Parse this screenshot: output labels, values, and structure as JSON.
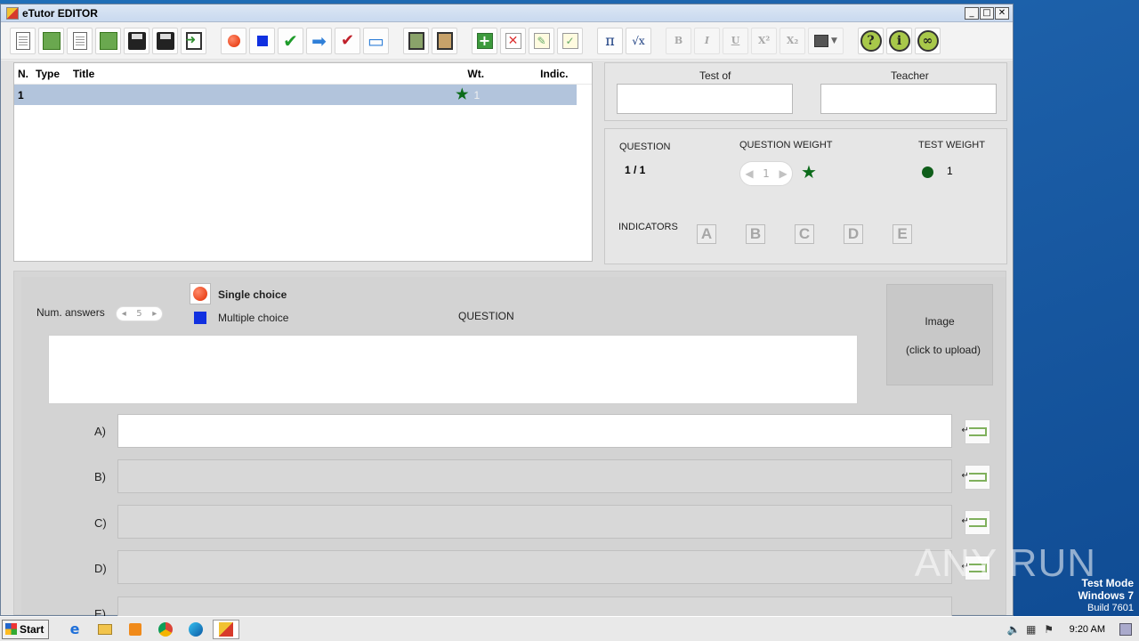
{
  "window": {
    "title": "eTutor EDITOR",
    "minimize": "_",
    "maximize": "□",
    "close": "✕"
  },
  "toolbar": {
    "math_pi": "π",
    "math_sqrt": "√x",
    "bold": "B",
    "italic": "I",
    "underline": "U",
    "superscript": "X²",
    "subscript": "X₂",
    "help": "?",
    "info": "i"
  },
  "question_list": {
    "headers": {
      "n": "N.",
      "type": "Type",
      "title": "Title",
      "wt": "Wt.",
      "indic": "Indic."
    },
    "rows": [
      {
        "n": "1",
        "type": "single-choice",
        "title": "",
        "wt": "1",
        "indic": ""
      }
    ]
  },
  "test_info": {
    "test_of_label": "Test of",
    "test_of_value": "",
    "teacher_label": "Teacher",
    "teacher_value": ""
  },
  "question_info": {
    "question_label": "QUESTION",
    "question_num": "1  /  1",
    "weight_label": "QUESTION WEIGHT",
    "weight_value": "1",
    "test_weight_label": "TEST WEIGHT",
    "test_weight_value": "1",
    "indicators_label": "INDICATORS",
    "indicators": [
      "A",
      "B",
      "C",
      "D",
      "E"
    ]
  },
  "editor": {
    "num_answers_label": "Num. answers",
    "num_answers_value": "5",
    "single_choice_label": "Single choice",
    "multiple_choice_label": "Multiple choice",
    "question_label": "QUESTION",
    "question_text": "",
    "image_label": "Image",
    "image_hint": "(click to upload)",
    "answers": [
      {
        "label": "A)",
        "value": ""
      },
      {
        "label": "B)",
        "value": ""
      },
      {
        "label": "C)",
        "value": ""
      },
      {
        "label": "D)",
        "value": ""
      },
      {
        "label": "E)",
        "value": ""
      }
    ]
  },
  "desktop": {
    "watermark": "ANY RUN",
    "test_mode": "Test Mode",
    "os": "Windows 7",
    "build": "Build 7601"
  },
  "taskbar": {
    "start": "Start",
    "clock": "9:20 AM"
  }
}
